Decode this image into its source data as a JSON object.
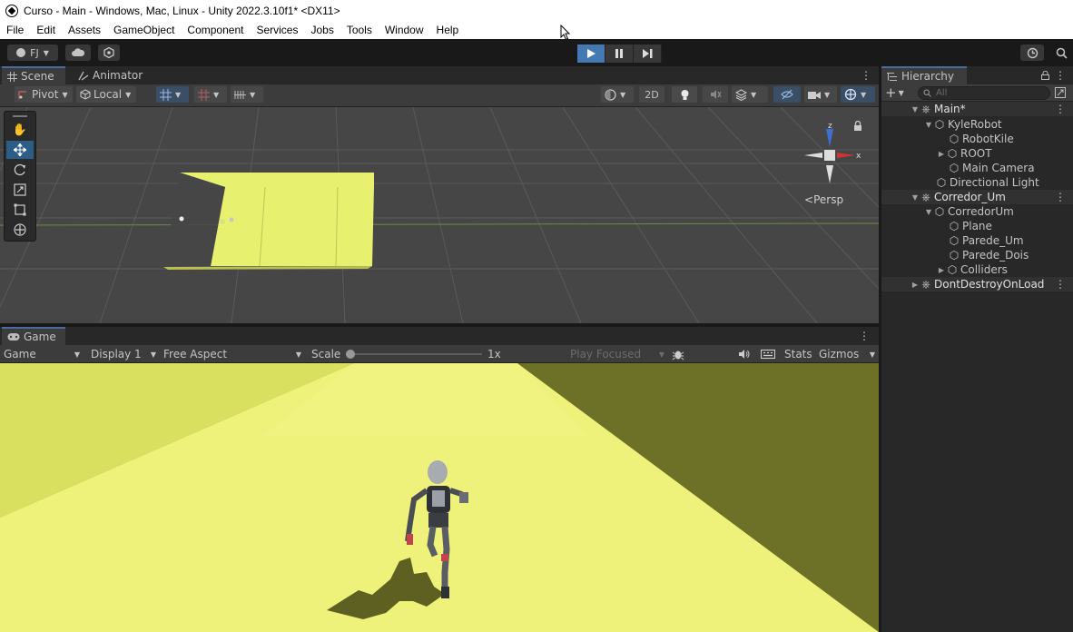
{
  "window": {
    "title": "Curso - Main - Windows, Mac, Linux - Unity 2022.3.10f1* <DX11>"
  },
  "menu": [
    "File",
    "Edit",
    "Assets",
    "GameObject",
    "Component",
    "Services",
    "Jobs",
    "Tools",
    "Window",
    "Help"
  ],
  "toolbar": {
    "account_label": "FJ",
    "play_icon": "play-icon",
    "pause_icon": "pause-icon",
    "step_icon": "step-icon"
  },
  "scene_panel": {
    "tabs": [
      {
        "label": "Scene",
        "icon": "grid-icon"
      },
      {
        "label": "Animator",
        "icon": "animator-icon"
      }
    ],
    "pivot_label": "Pivot",
    "local_label": "Local",
    "mode_2d_label": "2D",
    "persp_label": "Persp",
    "gizmo_axes": {
      "x": "x",
      "z": "z"
    }
  },
  "game_panel": {
    "tab_label": "Game",
    "game_dropdown": "Game",
    "display_dropdown": "Display 1",
    "aspect_dropdown": "Free Aspect",
    "scale_label": "Scale",
    "scale_value": "1x",
    "play_focused_label": "Play Focused",
    "stats_label": "Stats",
    "gizmos_label": "Gizmos"
  },
  "hierarchy": {
    "tab_label": "Hierarchy",
    "search_placeholder": "All",
    "rows": [
      {
        "label": "Main*",
        "kind": "scene",
        "expanded": true
      },
      {
        "label": "KyleRobot",
        "kind": "object",
        "expanded": true
      },
      {
        "label": "RobotKile",
        "kind": "object"
      },
      {
        "label": "ROOT",
        "kind": "object",
        "collapsed": true
      },
      {
        "label": "Main Camera",
        "kind": "object"
      },
      {
        "label": "Directional Light",
        "kind": "object"
      },
      {
        "label": "Corredor_Um",
        "kind": "scene",
        "expanded": true
      },
      {
        "label": "CorredorUm",
        "kind": "object",
        "expanded": true
      },
      {
        "label": "Plane",
        "kind": "object"
      },
      {
        "label": "Parede_Um",
        "kind": "object"
      },
      {
        "label": "Parede_Dois",
        "kind": "object"
      },
      {
        "label": "Colliders",
        "kind": "object",
        "collapsed": true
      },
      {
        "label": "DontDestroyOnLoad",
        "kind": "scene",
        "collapsed": true
      }
    ]
  },
  "colors": {
    "accent_play": "#4479b3",
    "floor_yellow": "#e4ee6a",
    "wall_olive": "#6f7227"
  }
}
